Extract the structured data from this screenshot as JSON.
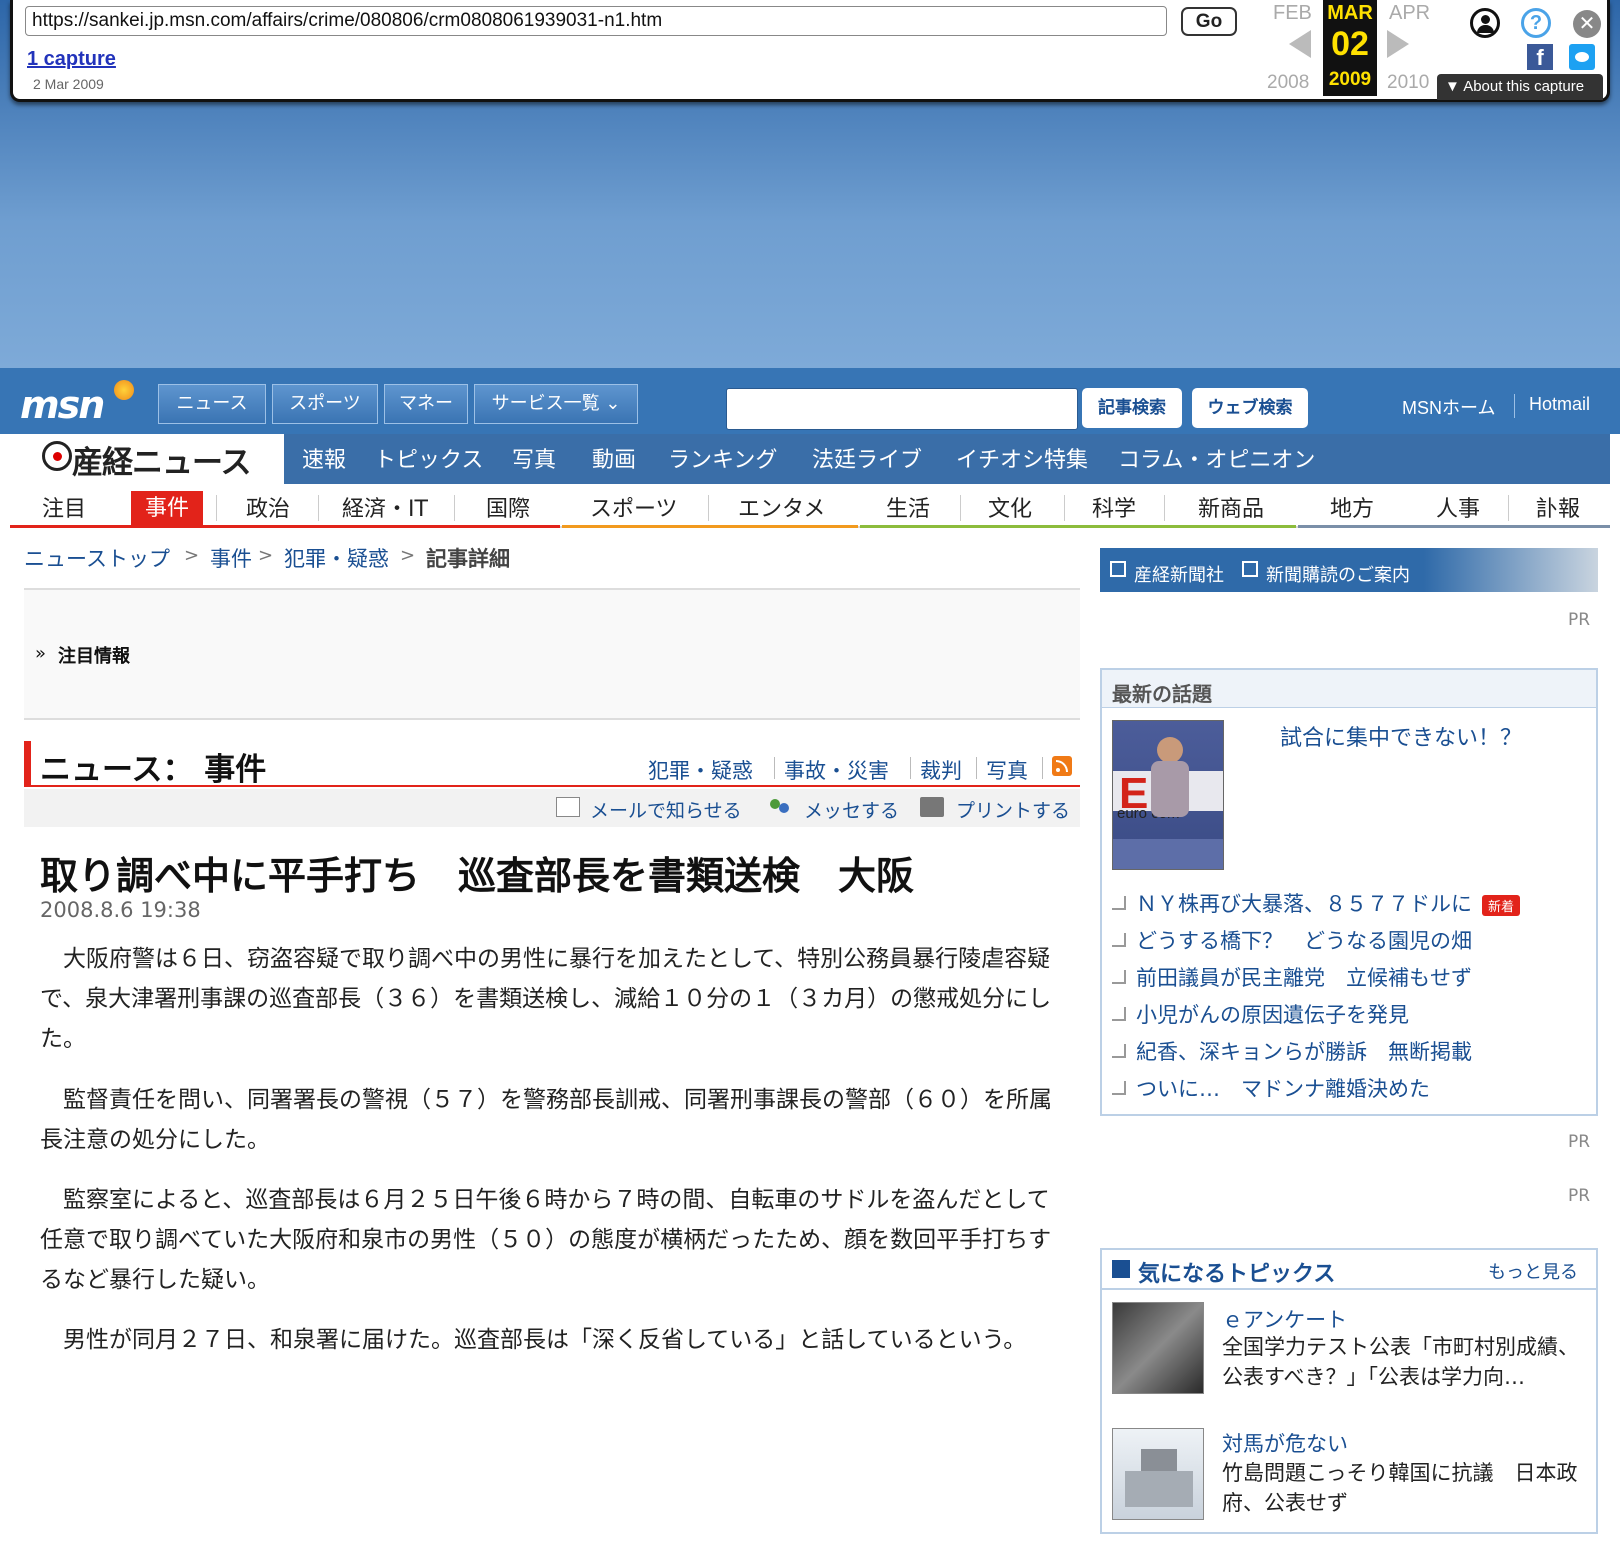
{
  "wayback": {
    "url": "https://sankei.jp.msn.com/affairs/crime/080806/crm0808061939031-n1.htm",
    "go_label": "Go",
    "captures_label": "1 capture",
    "capture_date": "2 Mar 2009",
    "prev_month": "FEB",
    "cur_month": "MAR",
    "next_month": "APR",
    "cur_day": "02",
    "prev_year": "2008",
    "cur_year": "2009",
    "next_year": "2010",
    "about_label": "About this capture"
  },
  "msn": {
    "logo": "msn",
    "nav": [
      "ニュース",
      "スポーツ",
      "マネー",
      "サービス一覧"
    ],
    "article_search_label": "記事検索",
    "web_search_label": "ウェブ検索",
    "home_link": "MSNホーム",
    "hotmail_link": "Hotmail"
  },
  "sankei": {
    "logo_text": "産経ニュース",
    "nav": [
      "速報",
      "トピックス",
      "写真",
      "動画",
      "ランキング",
      "法廷ライブ",
      "イチオシ特集",
      "コラム・オピニオン"
    ],
    "categories": [
      "注目",
      "事件",
      "政治",
      "経済・IT",
      "国際",
      "スポーツ",
      "エンタメ",
      "生活",
      "文化",
      "科学",
      "新商品",
      "地方",
      "人事",
      "訃報"
    ]
  },
  "breadcrumb": {
    "top": "ニューストップ",
    "cat": "事件",
    "sub": "犯罪・疑惑",
    "current": "記事詳細",
    "sep": ">"
  },
  "attention": {
    "title": "注目情報"
  },
  "section": {
    "title": "ニュース： 事件",
    "links": [
      "犯罪・疑惑",
      "事故・災害",
      "裁判",
      "写真"
    ],
    "tools": [
      "メールで知らせる",
      "メッセする",
      "プリントする"
    ]
  },
  "article": {
    "headline": "取り調べ中に平手打ち　巡査部長を書類送検　大阪",
    "date": "2008.8.6 19:38",
    "paragraphs": [
      "大阪府警は６日、窃盗容疑で取り調べ中の男性に暴行を加えたとして、特別公務員暴行陵虐容疑で、泉大津署刑事課の巡査部長（３６）を書類送検し、減給１０分の１（３カ月）の懲戒処分にした。",
      "監督責任を問い、同署署長の警視（５７）を警務部長訓戒、同署刑事課長の警部（６０）を所属長注意の処分にした。",
      "監察室によると、巡査部長は６月２５日午後６時から７時の間、自転車のサドルを盗んだとして任意で取り調べていた大阪府和泉市の男性（５０）の態度が横柄だったため、顔を数回平手打ちするなど暴行した疑い。",
      "男性が同月２７日、和泉署に届けた。巡査部長は「深く反省している」と話しているという。"
    ]
  },
  "sidebar": {
    "banner_left": "産経新聞社",
    "banner_right": "新聞購読のご案内",
    "pr": "PR",
    "topics_title": "最新の話題",
    "topics_photo_text": "euro com",
    "topics_feature": "試合に集中できない！？",
    "topics_items": [
      "ＮＹ株再び大暴落、８５７７ドルに",
      "どうする橋下？　どうなる園児の畑",
      "前田議員が民主離党　立候補もせず",
      "小児がんの原因遺伝子を発見",
      "紀香、深キョンらが勝訴　無断掲載",
      "ついに…　マドンナ離婚決めた"
    ],
    "new_badge": "新着",
    "kini_title": "気になるトピックス",
    "kini_more": "もっと見る",
    "kini_items": [
      {
        "cat": "ｅアンケート",
        "text": "全国学力テスト公表「市町村別成績、公表すべき？」「公表は学力向…"
      },
      {
        "cat": "対馬が危ない",
        "text": "竹島問題こっそり韓国に抗議　日本政府、公表せず"
      }
    ]
  },
  "colors": {
    "msn_blue": "#3775b5",
    "sankei_red": "#e2231a",
    "link_blue": "#1a4f92",
    "wayback_yellow": "#ffe100"
  }
}
